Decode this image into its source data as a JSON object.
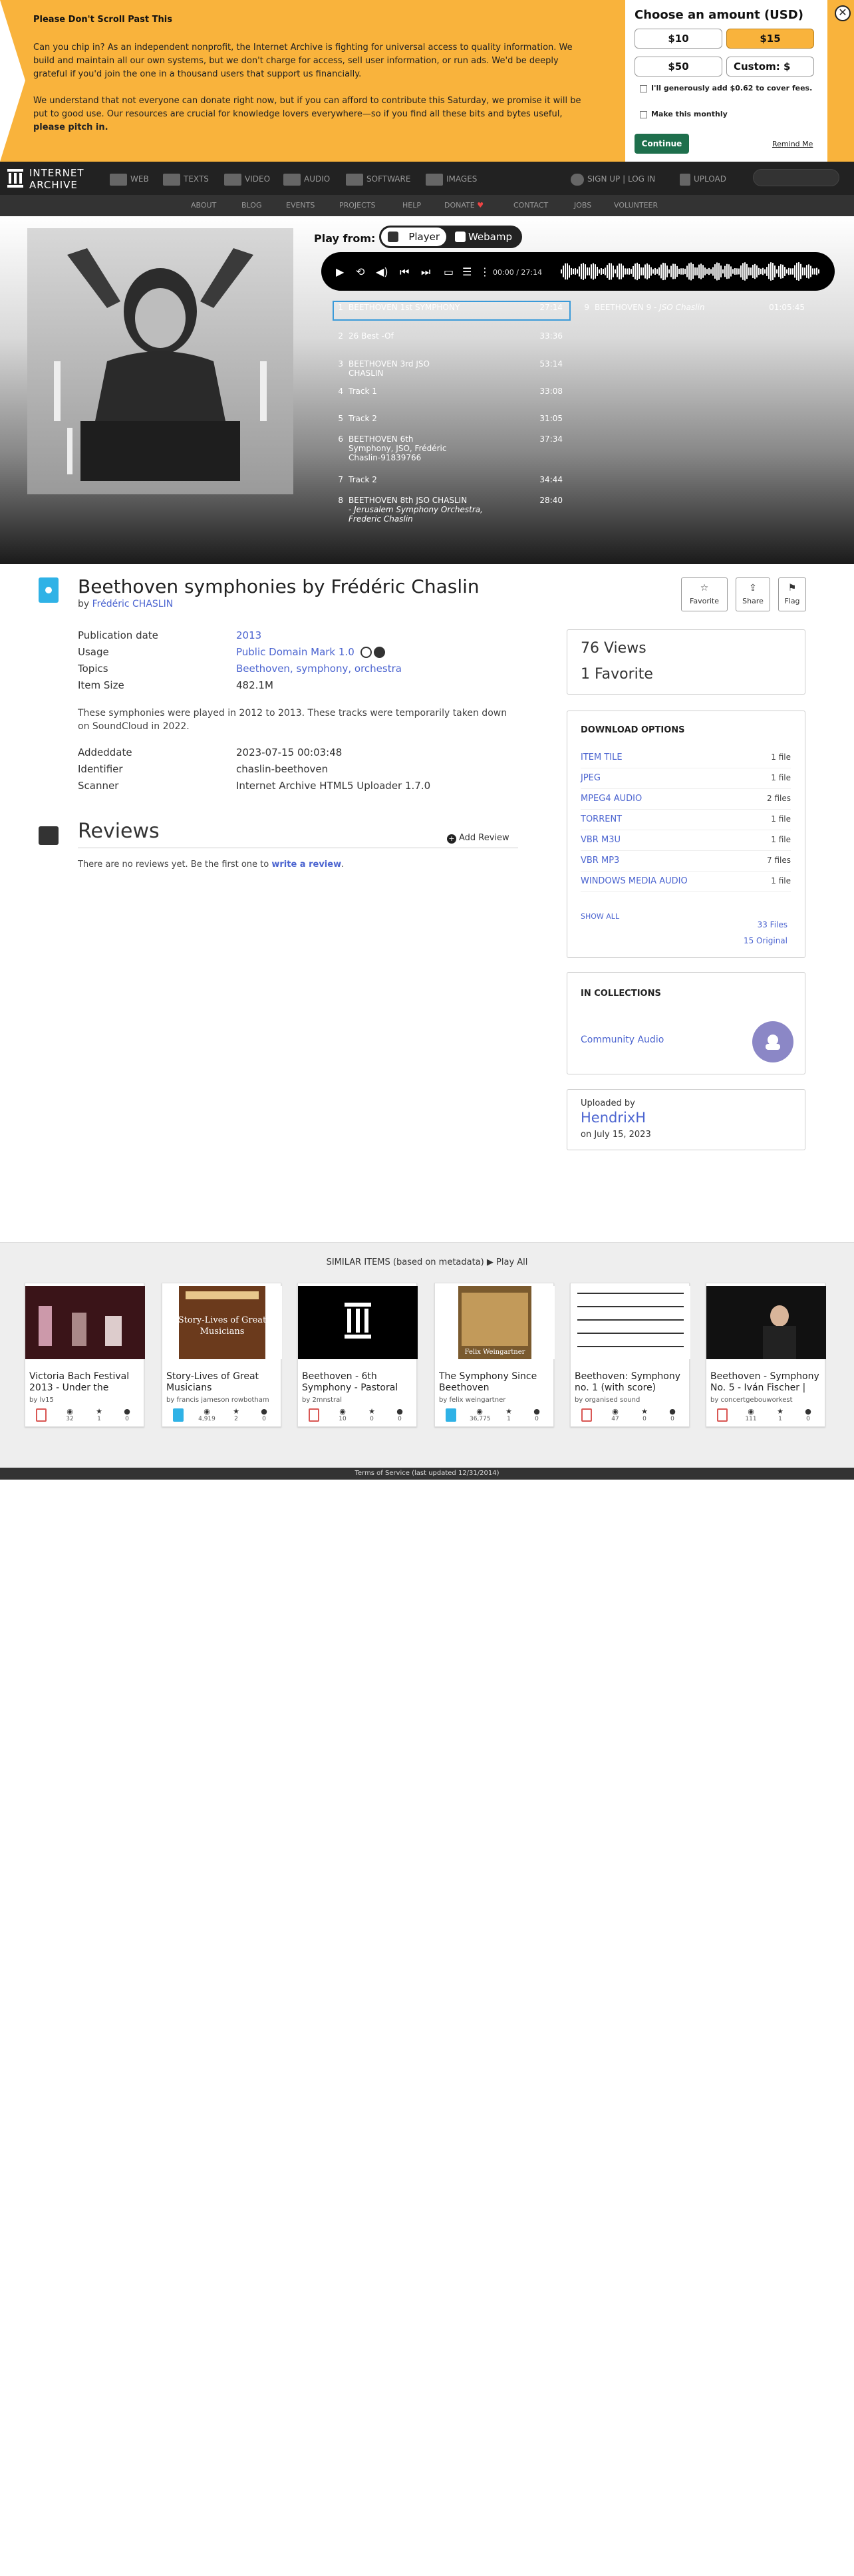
{
  "donation": {
    "title": "Please Don't Scroll Past This",
    "paragraph1": "Can you chip in? As an independent nonprofit, the Internet Archive is fighting for universal access to quality information. We build and maintain all our own systems, but we don't charge for access, sell user information, or run ads. We'd be deeply grateful if you'd join the one in a thousand users that support us financially.",
    "paragraph2_start": "We understand that not everyone can donate right now, but if you can afford to contribute this Saturday, we promise it will be put to good use. Our resources are crucial for knowledge lovers everywhere—so if you find all these bits and bytes useful, ",
    "paragraph2_bold": "please pitch in.",
    "choose_title": "Choose an amount (USD)",
    "amounts": [
      "$10",
      "$15",
      "$50",
      "Custom: $"
    ],
    "selected_amount": "$15",
    "cover_fees": "I'll generously add $0.62 to cover fees.",
    "monthly": "Make this monthly",
    "continue_label": "Continue",
    "remind_label": "Remind Me",
    "close_label": "✕",
    "accent_color": "#f9b33c"
  },
  "topnav": {
    "logo_line1": "INTERNET",
    "logo_line2": "ARCHIVE",
    "items": [
      "WEB",
      "TEXTS",
      "VIDEO",
      "AUDIO",
      "SOFTWARE",
      "IMAGES"
    ],
    "sign_in": "SIGN UP | LOG IN",
    "upload": "UPLOAD"
  },
  "subnav": {
    "items": [
      "ABOUT",
      "BLOG",
      "EVENTS",
      "PROJECTS",
      "HELP",
      "DONATE",
      "CONTACT",
      "JOBS",
      "VOLUNTEER"
    ]
  },
  "theatre": {
    "play_from": "Play from:",
    "player_label": "Player",
    "webamp_label": "Webamp",
    "time": "00:00 / 27:14",
    "tracks_left": [
      {
        "num": "1",
        "title": "BEETHOVEN 1st SYMPHONY",
        "duration": "27:14"
      },
      {
        "num": "2",
        "title": "26 Best -Of",
        "duration": "33:36"
      },
      {
        "num": "3",
        "title": "BEETHOVEN 3rd JSO CHASLIN",
        "duration": "53:14"
      },
      {
        "num": "4",
        "title": "Track 1",
        "duration": "33:08"
      },
      {
        "num": "5",
        "title": "Track 2",
        "duration": "31:05"
      },
      {
        "num": "6",
        "title": "BEETHOVEN 6th Symphony, JSO, Frédéric Chaslin-91839766",
        "duration": "37:34"
      },
      {
        "num": "7",
        "title": "Track 2",
        "duration": "34:44"
      },
      {
        "num": "8",
        "title": "BEETHOVEN 8th JSO CHASLIN",
        "subtitle": "- Jerusalem Symphony Orchestra, Frederic Chaslin",
        "duration": "28:40"
      }
    ],
    "tracks_right": [
      {
        "num": "9",
        "title": "BEETHOVEN 9 - ",
        "title_italic": "JSO Chaslin",
        "duration": "01:05:45"
      }
    ]
  },
  "item": {
    "title": "Beethoven symphonies by Frédéric Chaslin",
    "by_label": "by ",
    "creator": "Frédéric CHASLIN",
    "actions": [
      "Favorite",
      "Share",
      "Flag"
    ],
    "metadata": [
      {
        "key": "Publication date",
        "value": "2013",
        "link": true
      },
      {
        "key": "Usage",
        "value": "Public Domain Mark 1.0",
        "link": true
      },
      {
        "key": "Topics",
        "value": "Beethoven, symphony, orchestra",
        "link": true
      },
      {
        "key": "Item Size",
        "value": "482.1M",
        "link": false
      }
    ],
    "description": "These symphonies were played in 2012 to 2013. These tracks were temporarily taken down on SoundCloud in 2022.",
    "metadata2": [
      {
        "key": "Addeddate",
        "value": "2023-07-15 00:03:48"
      },
      {
        "key": "Identifier",
        "value": "chaslin-beethoven"
      },
      {
        "key": "Scanner",
        "value": "Internet Archive HTML5 Uploader 1.7.0"
      }
    ]
  },
  "reviews": {
    "title": "Reviews",
    "add_label": "Add Review",
    "empty_text": "There are no reviews yet. Be the first one to ",
    "write_link": "write a review",
    "empty_end": "."
  },
  "stats": {
    "views": "76 Views",
    "favorites": "1 Favorite"
  },
  "downloads": {
    "title": "DOWNLOAD OPTIONS",
    "rows": [
      {
        "name": "ITEM TILE",
        "count": "1 file"
      },
      {
        "name": "JPEG",
        "count": "1 file"
      },
      {
        "name": "MPEG4 AUDIO",
        "count": "2 files"
      },
      {
        "name": "TORRENT",
        "count": "1 file"
      },
      {
        "name": "VBR M3U",
        "count": "1 file"
      },
      {
        "name": "VBR MP3",
        "count": "7 files"
      },
      {
        "name": "WINDOWS MEDIA AUDIO",
        "count": "1 file"
      }
    ],
    "show_all": "SHOW ALL",
    "files_total": "33 Files",
    "original": "15 Original"
  },
  "collections": {
    "title": "IN COLLECTIONS",
    "item": "Community Audio"
  },
  "uploader": {
    "label": "Uploaded by",
    "name": "HendrixH",
    "date": "on July 15, 2023"
  },
  "similar": {
    "heading": "SIMILAR ITEMS (based on metadata)",
    "play_all": "Play All",
    "cards": [
      {
        "title": "Victoria Bach Festival 2013 - Under the",
        "by": "by lv15",
        "type": "movies",
        "views": "32",
        "favs": "1",
        "reviews": "0"
      },
      {
        "title": "Story-Lives of Great Musicians",
        "by": "by francis jameson rowbotham",
        "type": "texts",
        "views": "4,919",
        "favs": "2",
        "reviews": "0"
      },
      {
        "title": "Beethoven - 6th Symphony - Pastoral",
        "by": "by 2mnstral",
        "type": "movies",
        "views": "10",
        "favs": "0",
        "reviews": "0"
      },
      {
        "title": "The Symphony Since Beethoven",
        "by": "by felix weingartner",
        "type": "texts",
        "views": "36,775",
        "favs": "1",
        "reviews": "0"
      },
      {
        "title": "Beethoven: Symphony no. 1 (with score)",
        "by": "by organised sound",
        "type": "movies",
        "views": "47",
        "favs": "0",
        "reviews": "0"
      },
      {
        "title": "Beethoven - Symphony No. 5 - Iván Fischer |",
        "by": "by concertgebouworkest",
        "type": "movies",
        "views": "111",
        "favs": "1",
        "reviews": "0"
      }
    ]
  },
  "footer": {
    "text": "Terms of Service (last updated 12/31/2014)"
  }
}
